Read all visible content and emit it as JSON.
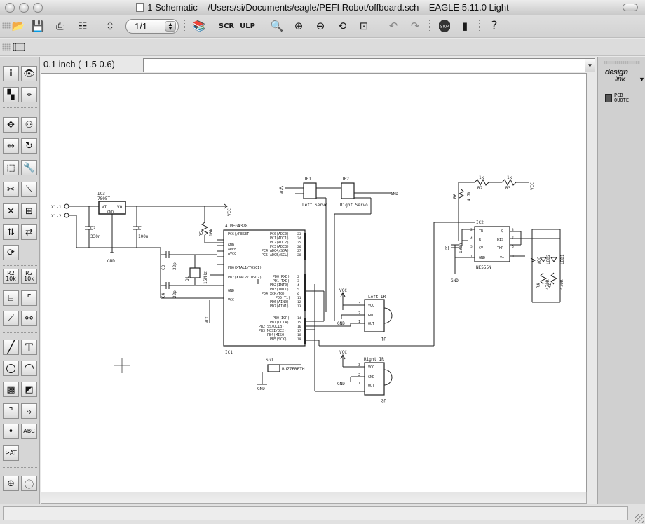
{
  "window": {
    "title": "1 Schematic – /Users/si/Documents/eagle/PEFI Robot/offboard.sch – EAGLE 5.11.0 Light"
  },
  "toolbar": {
    "sheet_value": "1/1",
    "icons": [
      "open-icon",
      "save-icon",
      "print-icon",
      "cam-processor-icon",
      "board-switch-icon",
      "sheet-select",
      "use-library-icon",
      "script-icon",
      "ulp-icon",
      "zoom-fit-icon",
      "zoom-in-icon",
      "zoom-out-icon",
      "redraw-icon",
      "zoom-select-icon",
      "undo-icon",
      "redo-icon",
      "stop-icon",
      "go-icon",
      "help-icon"
    ]
  },
  "coordinate_display": "0.1 inch (-1.5 0.6)",
  "command_line": {
    "value": ""
  },
  "palette": {
    "tools": [
      "info",
      "show",
      "display",
      "mark",
      "move",
      "copy",
      "mirror",
      "rotate",
      "group",
      "change",
      "cut",
      "paste",
      "delete",
      "add",
      "pinswap",
      "gateswap",
      "replace",
      "name",
      "value",
      "smash",
      "miter",
      "split",
      "invoke",
      "wire",
      "text",
      "circle",
      "arc",
      "rect",
      "polygon",
      "bus",
      "net",
      "junction",
      "label",
      "attribute",
      "erc",
      "errors"
    ]
  },
  "right_panel": {
    "designlink_label": "design",
    "designlink_sub": "link",
    "pcb_quote_line1": "PCB",
    "pcb_quote_line2": "QUOTE"
  },
  "schematic": {
    "x1_label": "X1-1",
    "x1b_label": "X1-2",
    "ic3_name": "IC3",
    "ic3_value": "7805T",
    "vi_label": "VI",
    "vo_label": "VO",
    "gnd_pin": "GND",
    "c2_name": "C2",
    "c2_value": "330n",
    "c1_name": "C1",
    "c1_value": "100n",
    "gnd1": "GND",
    "vcc1": "VCC",
    "r5_name": "R5",
    "r5_value": "10k",
    "mcu_name": "ATMEGA328",
    "mcu_ref": "IC1",
    "mcu_left_pins": [
      "PC6(/RESET)",
      "",
      "GND",
      "AREF",
      "AVCC",
      "",
      "PB6(XTAL1/TOSC1)",
      "",
      "PB7(XTAL2/TOSC2)",
      "",
      "GND",
      "",
      "VCC"
    ],
    "mcu_right_pins": [
      "PC0(ADC0)",
      "PC1(ADC1)",
      "PC2(ADC2)",
      "PC3(ADC3)",
      "PC4(ADC4/SDA)",
      "PC5(ADC5/SCL)",
      "",
      "",
      "PD0(RXD)",
      "PD1(TXD)",
      "PD2(INT0)",
      "PD3(INT1)",
      "PD4(XCK/T0)",
      "PD5(T1)",
      "PD6(AIN0)",
      "PD7(AIN1)",
      "",
      "PB0(ICP)",
      "PB1(OC1A)",
      "PB2(SS/OC1B)",
      "PB3(MOSI/OC2)",
      "PB4(MISO)",
      "PB5(SCK)"
    ],
    "mcu_right_pin_numbers": [
      "23",
      "24",
      "25",
      "26",
      "27",
      "28",
      "",
      "",
      "2",
      "3",
      "4",
      "5",
      "6",
      "11",
      "12",
      "13",
      "",
      "14",
      "15",
      "16",
      "17",
      "18",
      "19"
    ],
    "c3_name": "C3",
    "c3_value": "22p",
    "c4_name": "C4",
    "c4_value": "22p",
    "q1_name": "Q1",
    "q1_value": "16MHz",
    "vcc_mcu": "VCC",
    "jp1_name": "JP1",
    "jp1_label": "Left Servo",
    "jp2_name": "JP2",
    "jp2_label": "Right Servo",
    "vcc_servo": "VCC",
    "gnd_servo": "GND",
    "left_ir_label": "Left IR",
    "left_ir_pins": [
      "VCC",
      "GND",
      "OUT"
    ],
    "left_ir_pin_numbers": [
      "3",
      "2",
      "1"
    ],
    "left_ir_ref": "U1",
    "left_ir_vcc": "VCC",
    "left_ir_gnd": "GND",
    "right_ir_label": "Right IR",
    "right_ir_pins": [
      "VCC",
      "GND",
      "OUT"
    ],
    "right_ir_pin_numbers": [
      "3",
      "2",
      "1"
    ],
    "right_ir_ref": "U2",
    "right_ir_vcc": "VCC",
    "right_ir_gnd": "GND",
    "sg1_name": "SG1",
    "sg1_value": "BUZZERPTH",
    "gnd_buzzer": "GND",
    "ic2_name": "IC2",
    "ic2_value": "NE555N",
    "ic2_left_pins": [
      "TR",
      "R",
      "CV",
      "GND"
    ],
    "ic2_right_pins": [
      "Q",
      "DIS",
      "THR",
      "V+"
    ],
    "ic2_left_numbers": [
      "2",
      "4",
      "5",
      "1"
    ],
    "ic2_right_numbers": [
      "3",
      "7",
      "6",
      "8"
    ],
    "r2_name": "R2",
    "r2_value": "1k",
    "r3_name": "R3",
    "r3_value": "1k",
    "r6_name": "R6",
    "r6_value": "4.7k",
    "c5_name": "C5",
    "c5_value": "100n",
    "gnd_555": "GND",
    "vcc_555a": "VCC",
    "vcc_555b": "VCC",
    "led1": "LED1",
    "led2": "LED2",
    "r1_name": "R1",
    "r1_value": "470R",
    "r4_name": "R4",
    "r4_value": "470R"
  }
}
